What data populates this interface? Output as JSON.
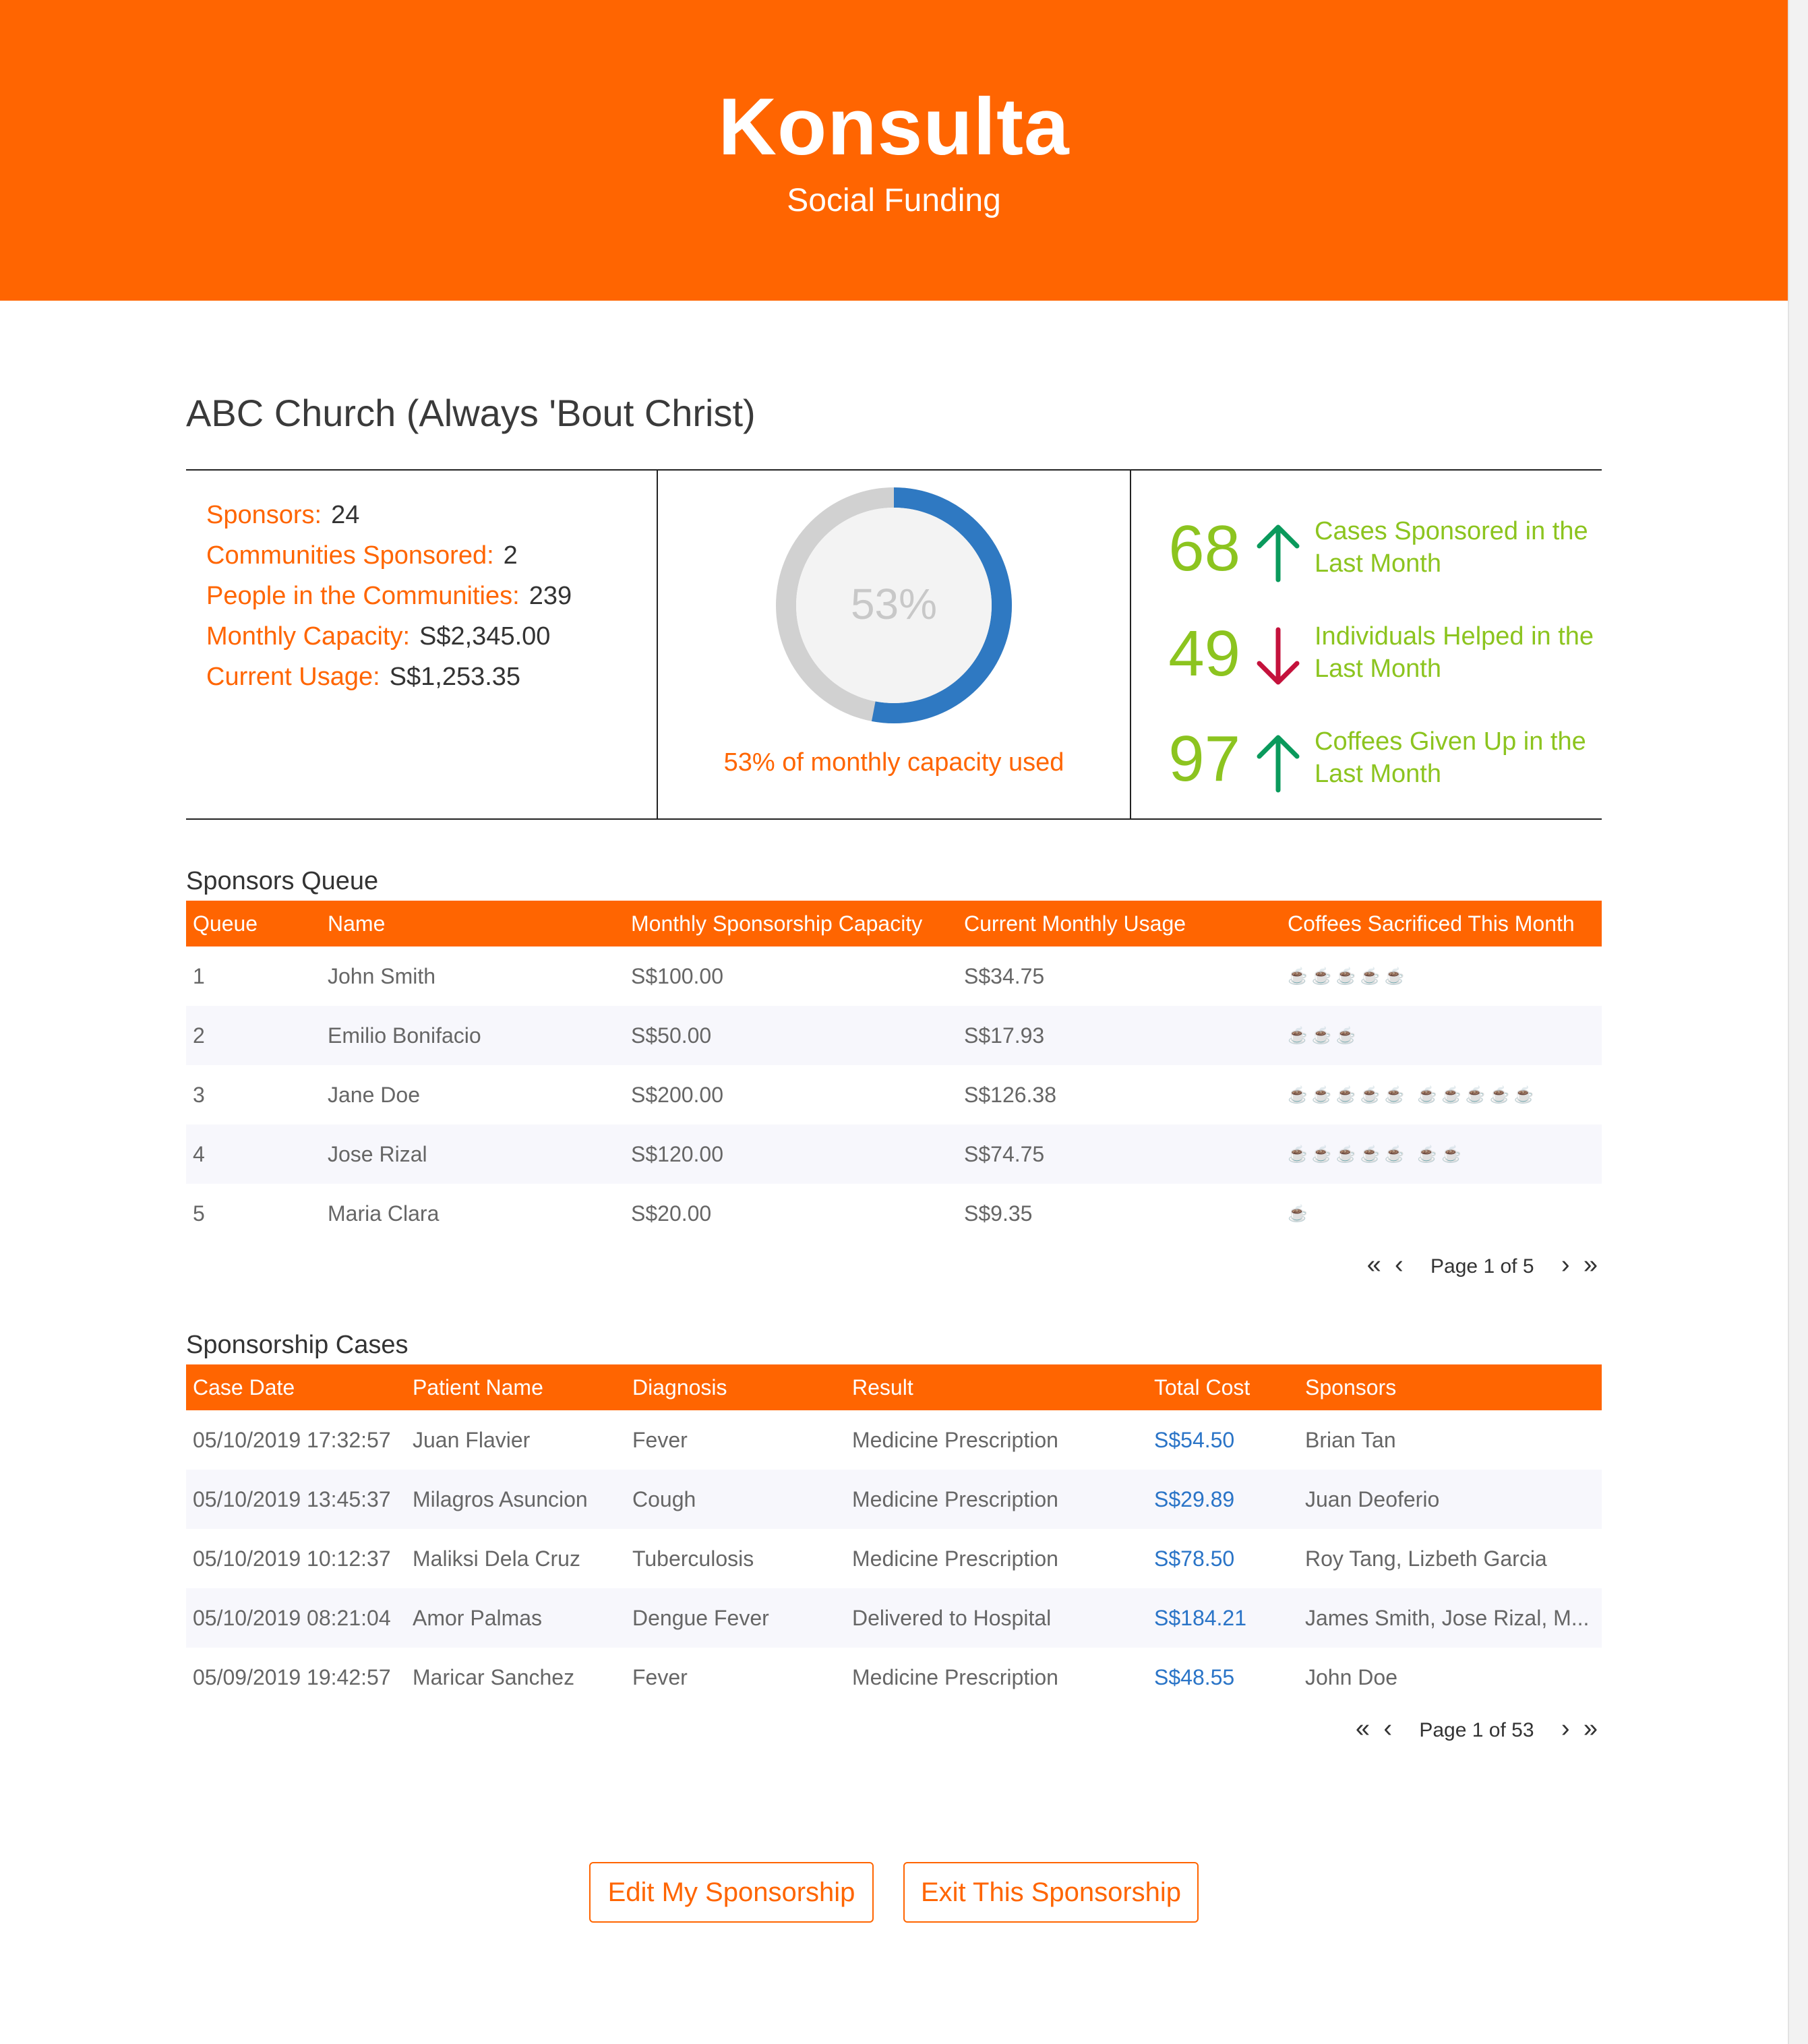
{
  "header": {
    "title": "Konsulta",
    "subtitle": "Social Funding"
  },
  "organization": {
    "name": "ABC Church (Always 'Bout Christ)"
  },
  "summary": {
    "items": [
      {
        "label": "Sponsors:",
        "value": "24"
      },
      {
        "label": "Communities Sponsored:",
        "value": "2"
      },
      {
        "label": "People in the Communities:",
        "value": "239"
      },
      {
        "label": "Monthly Capacity:",
        "value": "S$2,345.00"
      },
      {
        "label": "Current Usage:",
        "value": "S$1,253.35"
      }
    ]
  },
  "capacity": {
    "percent_text": "53%",
    "percent_value": 53,
    "caption": "53% of monthly capacity used",
    "colors": {
      "used": "#2f79c2",
      "remaining": "#d1d1d1",
      "center": "#f3f3f3"
    }
  },
  "trends": [
    {
      "value": "68",
      "direction": "up",
      "icon": "arrow-up-icon",
      "label": "Cases Sponsored in the Last Month",
      "color": "#0a9a5c"
    },
    {
      "value": "49",
      "direction": "down",
      "icon": "arrow-down-icon",
      "label": "Individuals Helped in the Last Month",
      "color": "#c4123c"
    },
    {
      "value": "97",
      "direction": "up",
      "icon": "arrow-up-icon",
      "label": "Coffees Given Up in the Last Month",
      "color": "#0a9a5c"
    }
  ],
  "sponsors_queue": {
    "title": "Sponsors Queue",
    "columns": [
      "Queue",
      "Name",
      "Monthly Sponsorship Capacity",
      "Current Monthly Usage",
      "Coffees Sacrificed This Month"
    ],
    "coffee_icon": "coffee-cup-icon",
    "rows": [
      {
        "queue": "1",
        "name": "John Smith",
        "capacity": "S$100.00",
        "usage": "S$34.75",
        "coffees": "☕☕☕☕☕"
      },
      {
        "queue": "2",
        "name": "Emilio Bonifacio",
        "capacity": "S$50.00",
        "usage": "S$17.93",
        "coffees": "☕☕☕"
      },
      {
        "queue": "3",
        "name": "Jane Doe",
        "capacity": "S$200.00",
        "usage": "S$126.38",
        "coffees": "☕☕☕☕☕ ☕☕☕☕☕"
      },
      {
        "queue": "4",
        "name": "Jose Rizal",
        "capacity": "S$120.00",
        "usage": "S$74.75",
        "coffees": "☕☕☕☕☕ ☕☕"
      },
      {
        "queue": "5",
        "name": "Maria Clara",
        "capacity": "S$20.00",
        "usage": "S$9.35",
        "coffees": "☕"
      }
    ],
    "pager": {
      "first": "«",
      "prev": "‹",
      "text": "Page 1 of 5",
      "next": "›",
      "last": "»"
    }
  },
  "sponsorship_cases": {
    "title": "Sponsorship Cases",
    "columns": [
      "Case Date",
      "Patient Name",
      "Diagnosis",
      "Result",
      "Total Cost",
      "Sponsors"
    ],
    "rows": [
      {
        "date": "05/10/2019 17:32:57",
        "patient": "Juan Flavier",
        "diagnosis": "Fever",
        "result": "Medicine Prescription",
        "cost": "S$54.50",
        "sponsors": "Brian Tan"
      },
      {
        "date": "05/10/2019 13:45:37",
        "patient": "Milagros Asuncion",
        "diagnosis": "Cough",
        "result": "Medicine Prescription",
        "cost": "S$29.89",
        "sponsors": "Juan Deoferio"
      },
      {
        "date": "05/10/2019 10:12:37",
        "patient": "Maliksi Dela Cruz",
        "diagnosis": "Tuberculosis",
        "result": "Medicine Prescription",
        "cost": "S$78.50",
        "sponsors": "Roy Tang, Lizbeth Garcia"
      },
      {
        "date": "05/10/2019 08:21:04",
        "patient": "Amor Palmas",
        "diagnosis": "Dengue Fever",
        "result": "Delivered to Hospital",
        "cost": "S$184.21",
        "sponsors": "James Smith, Jose Rizal, M..."
      },
      {
        "date": "05/09/2019 19:42:57",
        "patient": "Maricar Sanchez",
        "diagnosis": "Fever",
        "result": "Medicine Prescription",
        "cost": "S$48.55",
        "sponsors": "John Doe"
      }
    ],
    "pager": {
      "first": "«",
      "prev": "‹",
      "text": "Page 1 of 53",
      "next": "›",
      "last": "»"
    }
  },
  "actions": {
    "edit_label": "Edit My Sponsorship",
    "exit_label": "Exit This Sponsorship"
  },
  "colors": {
    "brand": "#ff6501",
    "accent_green": "#8cc41f",
    "link_blue": "#2a74c7"
  }
}
